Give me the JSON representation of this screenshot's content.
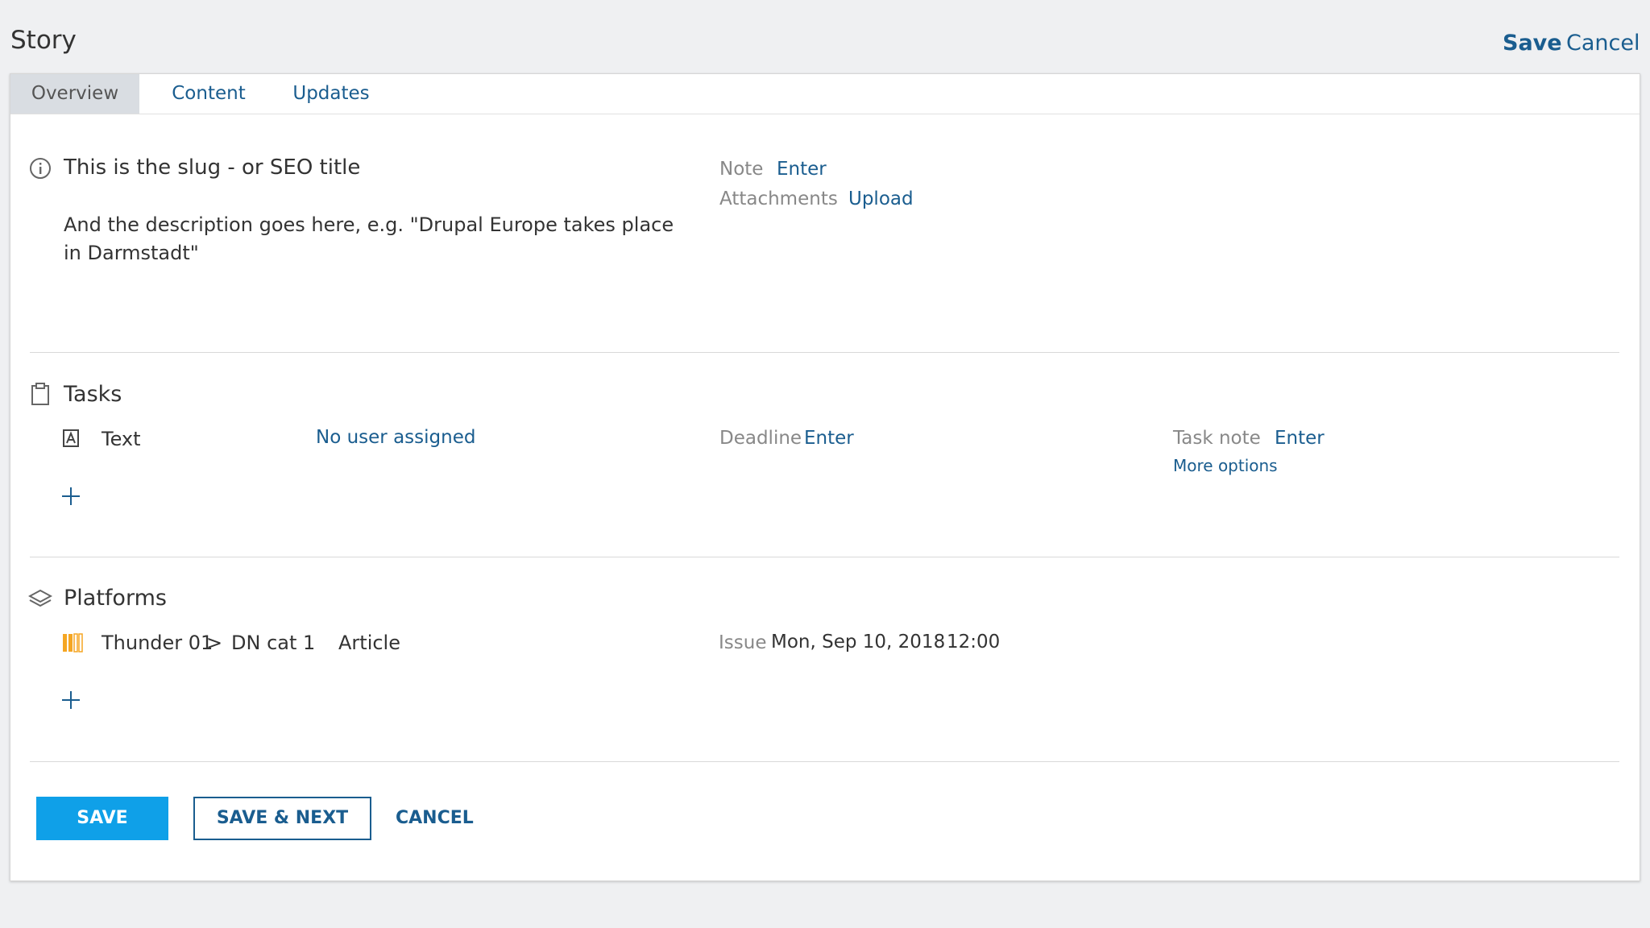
{
  "header": {
    "title": "Story",
    "save_label": "Save",
    "cancel_label": "Cancel"
  },
  "tabs": [
    {
      "label": "Overview",
      "active": true
    },
    {
      "label": "Content",
      "active": false
    },
    {
      "label": "Updates",
      "active": false
    }
  ],
  "overview": {
    "slug": "This is the slug - or SEO title",
    "description": "And the description goes here, e.g. \"Drupal Europe takes place in Darmstadt\"",
    "note_label": "Note",
    "note_action": "Enter",
    "attachments_label": "Attachments",
    "attachments_action": "Upload"
  },
  "tasks": {
    "heading": "Tasks",
    "item": {
      "name": "Text",
      "assignee": "No user assigned",
      "deadline_label": "Deadline",
      "deadline_action": "Enter",
      "task_note_label": "Task note",
      "task_note_action": "Enter",
      "more_options": "More options"
    }
  },
  "platforms": {
    "heading": "Platforms",
    "item": {
      "path_a": "Thunder 01",
      "separator": ">",
      "path_b": "DN cat 1",
      "type": "Article",
      "issue_label": "Issue",
      "issue_date": "Mon, Sep 10, 2018",
      "issue_time": "12:00"
    }
  },
  "actions": {
    "save": "SAVE",
    "save_next": "SAVE & NEXT",
    "cancel": "CANCEL"
  },
  "colors": {
    "accent": "#1a5d8f",
    "primary_button": "#0fa0e8",
    "platform_icon": "#f5a623"
  },
  "icons": [
    "info-icon",
    "clipboard-icon",
    "text-task-icon",
    "add-icon",
    "layers-icon",
    "platform-icon"
  ]
}
